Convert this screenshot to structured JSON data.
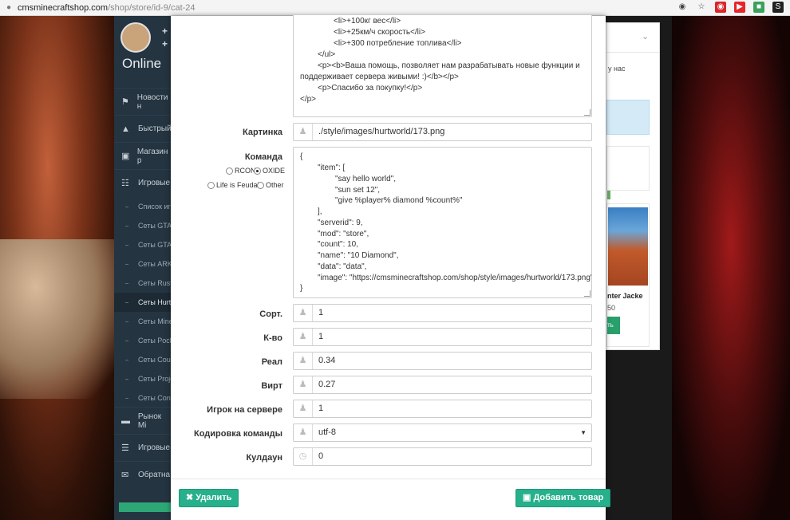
{
  "browser": {
    "url_domain": "cmsminecraftshop.com",
    "url_path": "/shop/store/id-9/cat-24"
  },
  "sidebar": {
    "status": "Online",
    "items": [
      {
        "label": "Новости н",
        "icon": "bullhorn-icon"
      },
      {
        "label": "Быстрый",
        "icon": "flask-icon"
      },
      {
        "label": "Магазин р",
        "icon": "money-icon"
      },
      {
        "label": "Игровые",
        "icon": "cart-icon"
      }
    ],
    "subitems": [
      "Список игр",
      "Сеты GTA",
      "Сеты GTA",
      "Сеты ARK",
      "Сеты Rust",
      "Сеты Hurtw",
      "Сеты Mine",
      "Сеты Pock",
      "Сеты Coun",
      "Сеты Proje",
      "Сеты Cona"
    ],
    "bottom_items": [
      {
        "label": "Рынок Mi",
        "icon": "card-icon"
      },
      {
        "label": "Игровые",
        "icon": "server-icon"
      },
      {
        "label": "Обратна",
        "icon": "mail-icon"
      }
    ]
  },
  "right_panel": {
    "text": "у нас",
    "product_name": "nter Jacke",
    "product_price": "50",
    "buy_label": "ть"
  },
  "modal": {
    "description_lines": [
      "<li>+100кг вес</li>",
      "<li>+25км/ч скорость</li>",
      "<li>+300 потребление топлива</li>",
      "</ul>",
      "<p><b>Ваша помощь, позволяет нам разрабатывать новые функции и",
      "поддерживает сервера живыми! :)</b></p>",
      "<p>Спасибо за покупку!</p>",
      "</p>"
    ],
    "image_label": "Картинка",
    "image_value": "./style/images/hurtworld/173.png",
    "command_label": "Команда",
    "radio_options": [
      {
        "label": "RCON",
        "checked": false
      },
      {
        "label": "OXIDE",
        "checked": true
      },
      {
        "label": "Life is Feudal",
        "checked": false
      },
      {
        "label": "Other",
        "checked": false
      }
    ],
    "command_lines": [
      "{",
      "\"item\": [",
      "\"say hello world\",",
      "\"sun set 12\",",
      "\"give %player% diamond %count%\"",
      "],",
      "\"serverid\": 9,",
      "\"mod\": \"store\",",
      "\"count\": 10,",
      "\"name\": \"10 Diamond\",",
      "\"data\": \"data\",",
      "\"image\": \"https://cmsminecraftshop.com/shop/style/images/hurtworld/173.png\"",
      "}"
    ],
    "sort_label": "Сорт.",
    "sort_value": "1",
    "qty_label": "К-во",
    "qty_value": "1",
    "real_label": "Реал",
    "real_value": "0.34",
    "virt_label": "Вирт",
    "virt_value": "0.27",
    "player_label": "Игрок на сервере",
    "player_value": "1",
    "encoding_label": "Кодировка команды",
    "encoding_value": "utf-8",
    "cooldown_label": "Кулдаун",
    "cooldown_value": "0",
    "delete_label": "Удалить",
    "add_label": "Добавить товар"
  },
  "colors": {
    "accent": "#26b08b",
    "sidebar": "#243440"
  }
}
